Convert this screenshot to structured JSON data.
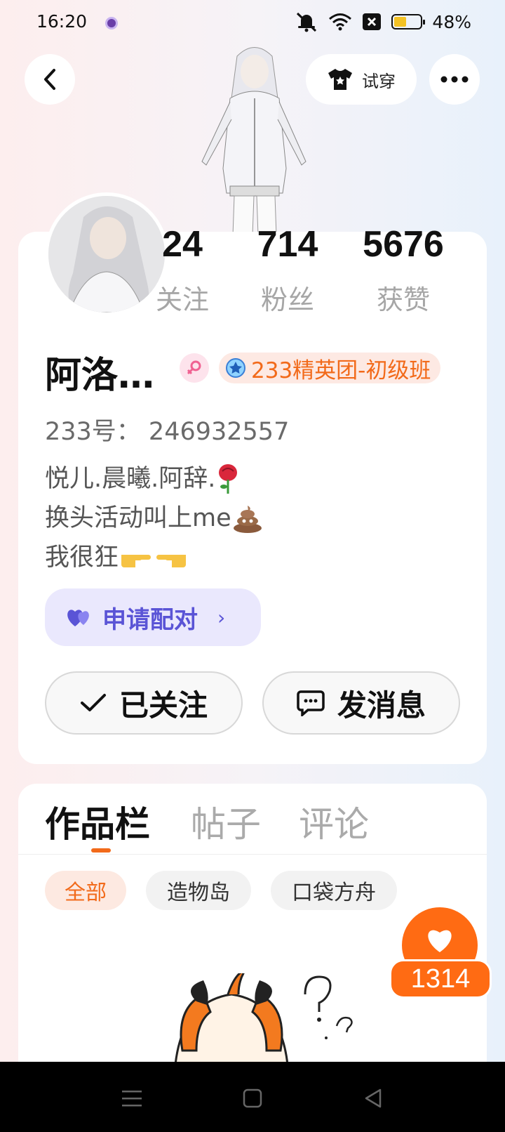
{
  "status_bar": {
    "time": "16:20",
    "battery_text": "48%",
    "battery_level": 0.48
  },
  "header": {
    "tryon_label": "试穿"
  },
  "stats": [
    {
      "value": "24",
      "label": "关注"
    },
    {
      "value": "714",
      "label": "粉丝"
    },
    {
      "value": "5676",
      "label": "获赞"
    }
  ],
  "profile": {
    "name": "阿洛…",
    "rank_badge": "233精英团-初级班",
    "uid": "233号： 246932557",
    "bio": [
      "悦儿.晨曦.阿辞.",
      "换头活动叫上me",
      "我很狂"
    ]
  },
  "pair_button": {
    "label": "申请配对"
  },
  "actions": {
    "follow_label": "已关注",
    "message_label": "发消息"
  },
  "tabs": [
    "作品栏",
    "帖子",
    "评论"
  ],
  "filters": [
    "全部",
    "造物岛",
    "口袋方舟"
  ],
  "like": {
    "count": "1314"
  },
  "colors": {
    "accent": "#ff6b13",
    "pair": "#5a54d6",
    "rank": "#f26a1a"
  },
  "icons": [
    "back-icon",
    "tshirt-icon",
    "more-icon",
    "venus-icon",
    "rank-icon",
    "heart-pair-icon",
    "check-icon",
    "chat-icon",
    "heart-icon",
    "menu-icon",
    "home-icon",
    "back-triangle-icon"
  ]
}
